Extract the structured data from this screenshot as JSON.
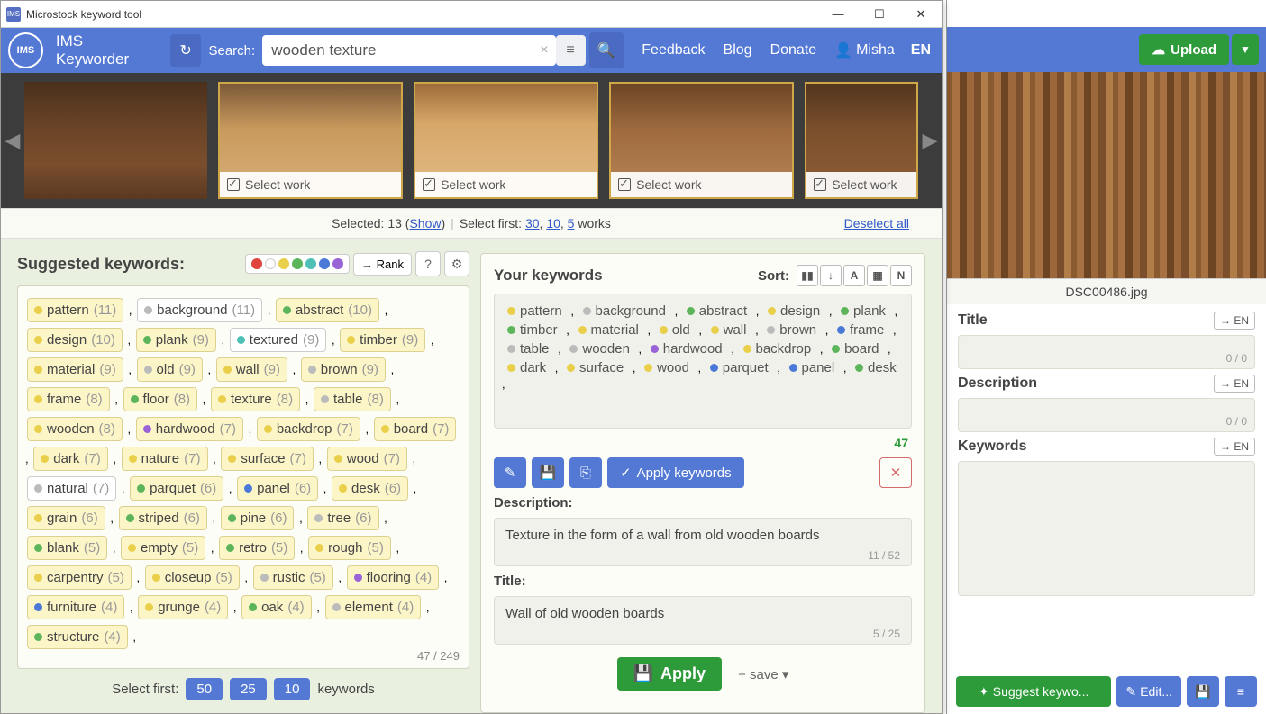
{
  "popup": {
    "window_title": "Microstock keyword tool",
    "logo_text": "IMS",
    "app_title": "IMS Keyworder",
    "search_label": "Search:",
    "search_value": "wooden texture",
    "header_links": {
      "feedback": "Feedback",
      "blog": "Blog",
      "donate": "Donate"
    },
    "user_name": "Misha",
    "language": "EN"
  },
  "carousel": {
    "select_label": "Select work"
  },
  "stats": {
    "selected_prefix": "Selected: ",
    "selected_count": "13",
    "show": "Show",
    "select_first_prefix": "Select first: ",
    "nums": [
      "30",
      "10",
      "5"
    ],
    "works_suffix": " works",
    "deselect": "Deselect all"
  },
  "suggested": {
    "heading": "Suggested keywords:",
    "rank_label": "→ Rank",
    "counter": "47 / 249",
    "tags": [
      {
        "w": "pattern",
        "n": "11",
        "c": "c-yellow"
      },
      {
        "w": "background",
        "n": "11",
        "c": "c-grey",
        "white": true
      },
      {
        "w": "abstract",
        "n": "10",
        "c": "c-green"
      },
      {
        "w": "design",
        "n": "10",
        "c": "c-yellow"
      },
      {
        "w": "plank",
        "n": "9",
        "c": "c-green"
      },
      {
        "w": "textured",
        "n": "9",
        "c": "c-teal",
        "white": true
      },
      {
        "w": "timber",
        "n": "9",
        "c": "c-yellow"
      },
      {
        "w": "material",
        "n": "9",
        "c": "c-yellow"
      },
      {
        "w": "old",
        "n": "9",
        "c": "c-grey"
      },
      {
        "w": "wall",
        "n": "9",
        "c": "c-yellow"
      },
      {
        "w": "brown",
        "n": "9",
        "c": "c-grey"
      },
      {
        "w": "frame",
        "n": "8",
        "c": "c-yellow"
      },
      {
        "w": "floor",
        "n": "8",
        "c": "c-green"
      },
      {
        "w": "texture",
        "n": "8",
        "c": "c-yellow"
      },
      {
        "w": "table",
        "n": "8",
        "c": "c-grey"
      },
      {
        "w": "wooden",
        "n": "8",
        "c": "c-yellow"
      },
      {
        "w": "hardwood",
        "n": "7",
        "c": "c-purple"
      },
      {
        "w": "backdrop",
        "n": "7",
        "c": "c-yellow"
      },
      {
        "w": "board",
        "n": "7",
        "c": "c-yellow"
      },
      {
        "w": "dark",
        "n": "7",
        "c": "c-yellow"
      },
      {
        "w": "nature",
        "n": "7",
        "c": "c-yellow"
      },
      {
        "w": "surface",
        "n": "7",
        "c": "c-yellow"
      },
      {
        "w": "wood",
        "n": "7",
        "c": "c-yellow"
      },
      {
        "w": "natural",
        "n": "7",
        "c": "c-grey",
        "white": true
      },
      {
        "w": "parquet",
        "n": "6",
        "c": "c-green"
      },
      {
        "w": "panel",
        "n": "6",
        "c": "c-blue"
      },
      {
        "w": "desk",
        "n": "6",
        "c": "c-yellow"
      },
      {
        "w": "grain",
        "n": "6",
        "c": "c-yellow"
      },
      {
        "w": "striped",
        "n": "6",
        "c": "c-green"
      },
      {
        "w": "pine",
        "n": "6",
        "c": "c-green"
      },
      {
        "w": "tree",
        "n": "6",
        "c": "c-grey"
      },
      {
        "w": "blank",
        "n": "5",
        "c": "c-green"
      },
      {
        "w": "empty",
        "n": "5",
        "c": "c-yellow"
      },
      {
        "w": "retro",
        "n": "5",
        "c": "c-green"
      },
      {
        "w": "rough",
        "n": "5",
        "c": "c-yellow"
      },
      {
        "w": "carpentry",
        "n": "5",
        "c": "c-yellow"
      },
      {
        "w": "closeup",
        "n": "5",
        "c": "c-yellow"
      },
      {
        "w": "rustic",
        "n": "5",
        "c": "c-grey"
      },
      {
        "w": "flooring",
        "n": "4",
        "c": "c-purple"
      },
      {
        "w": "furniture",
        "n": "4",
        "c": "c-blue"
      },
      {
        "w": "grunge",
        "n": "4",
        "c": "c-yellow"
      },
      {
        "w": "oak",
        "n": "4",
        "c": "c-green"
      },
      {
        "w": "element",
        "n": "4",
        "c": "c-grey"
      },
      {
        "w": "structure",
        "n": "4",
        "c": "c-green"
      }
    ],
    "select_first_label": "Select first:",
    "select_first_nums": [
      "50",
      "25",
      "10"
    ],
    "select_first_suffix": "keywords"
  },
  "your": {
    "heading": "Your keywords",
    "sort_label": "Sort:",
    "count": "47",
    "tags": [
      {
        "w": "pattern",
        "c": "c-yellow"
      },
      {
        "w": "background",
        "c": "c-grey"
      },
      {
        "w": "abstract",
        "c": "c-green"
      },
      {
        "w": "design",
        "c": "c-yellow"
      },
      {
        "w": "plank",
        "c": "c-green"
      },
      {
        "w": "timber",
        "c": "c-green"
      },
      {
        "w": "material",
        "c": "c-yellow"
      },
      {
        "w": "old",
        "c": "c-yellow"
      },
      {
        "w": "wall",
        "c": "c-yellow"
      },
      {
        "w": "brown",
        "c": "c-grey"
      },
      {
        "w": "frame",
        "c": "c-blue"
      },
      {
        "w": "table",
        "c": "c-grey"
      },
      {
        "w": "wooden",
        "c": "c-grey"
      },
      {
        "w": "hardwood",
        "c": "c-purple"
      },
      {
        "w": "backdrop",
        "c": "c-yellow"
      },
      {
        "w": "board",
        "c": "c-green"
      },
      {
        "w": "dark",
        "c": "c-yellow"
      },
      {
        "w": "surface",
        "c": "c-yellow"
      },
      {
        "w": "wood",
        "c": "c-yellow"
      },
      {
        "w": "parquet",
        "c": "c-blue"
      },
      {
        "w": "panel",
        "c": "c-blue"
      },
      {
        "w": "desk",
        "c": "c-green"
      }
    ],
    "apply_keywords": "Apply keywords",
    "description_label": "Description:",
    "description_value": "Texture in the form of a wall from old wooden boards",
    "description_count": "11 / 52",
    "title_label": "Title:",
    "title_value": "Wall of old wooden boards",
    "title_count": "5 / 25",
    "apply_label": "Apply",
    "save_label": "+ save ▾"
  },
  "side": {
    "upload": "Upload",
    "filename": "DSC00486.jpg",
    "title_label": "Title",
    "desc_label": "Description",
    "kw_label": "Keywords",
    "en_btn": "→ EN",
    "count_00": "0 / 0",
    "suggest": "Suggest keywo...",
    "edit": "Edit..."
  }
}
